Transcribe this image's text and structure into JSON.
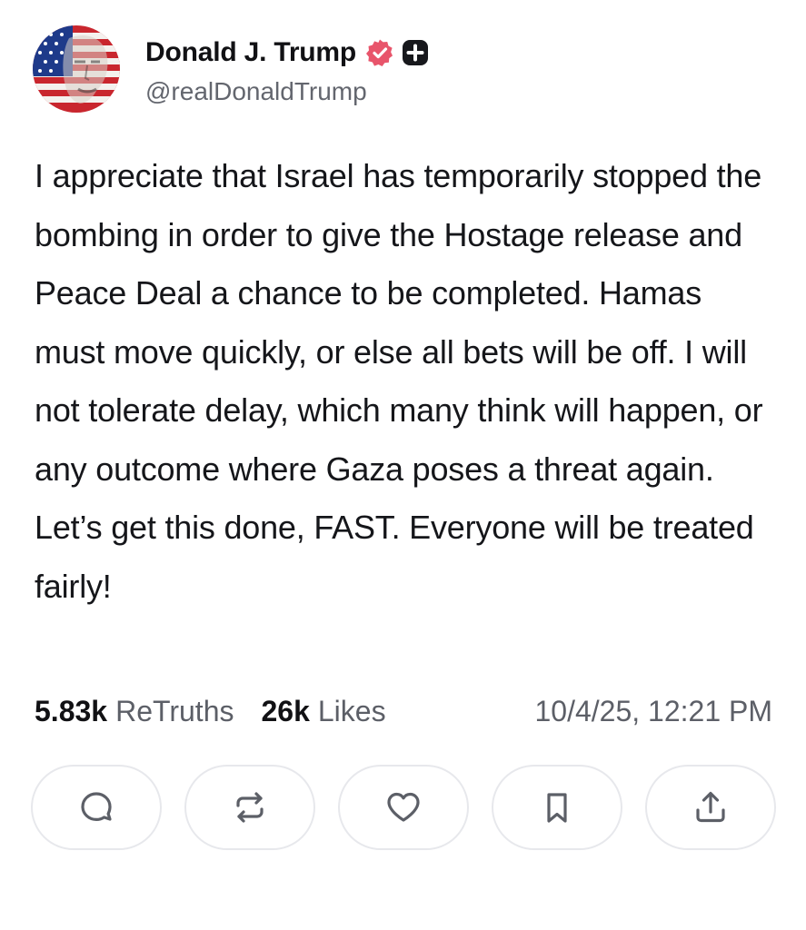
{
  "post": {
    "author": {
      "display_name": "Donald J. Trump",
      "handle": "@realDonaldTrump",
      "avatar_icon": "flag-portrait-avatar",
      "verified_icon": "verified-badge-icon",
      "verified_color": "#e8556b",
      "plus_icon": "truth-plus-badge-icon"
    },
    "text": "I appreciate that Israel has temporarily stopped the bombing in order to give the Hostage release and Peace Deal a chance to be completed. Hamas must move quickly, or else all bets will be off. I will not tolerate delay, which many think will happen, or any outcome where Gaza poses a threat again. Let’s get this done, FAST. Everyone will be treated fairly!",
    "stats": {
      "retruths_count": "5.83k",
      "retruths_label": "ReTruths",
      "likes_count": "26k",
      "likes_label": "Likes",
      "timestamp": "10/4/25, 12:21 PM"
    },
    "actions": [
      {
        "icon": "reply-icon"
      },
      {
        "icon": "retruth-icon"
      },
      {
        "icon": "like-heart-icon"
      },
      {
        "icon": "bookmark-icon"
      },
      {
        "icon": "share-upload-icon"
      }
    ]
  }
}
